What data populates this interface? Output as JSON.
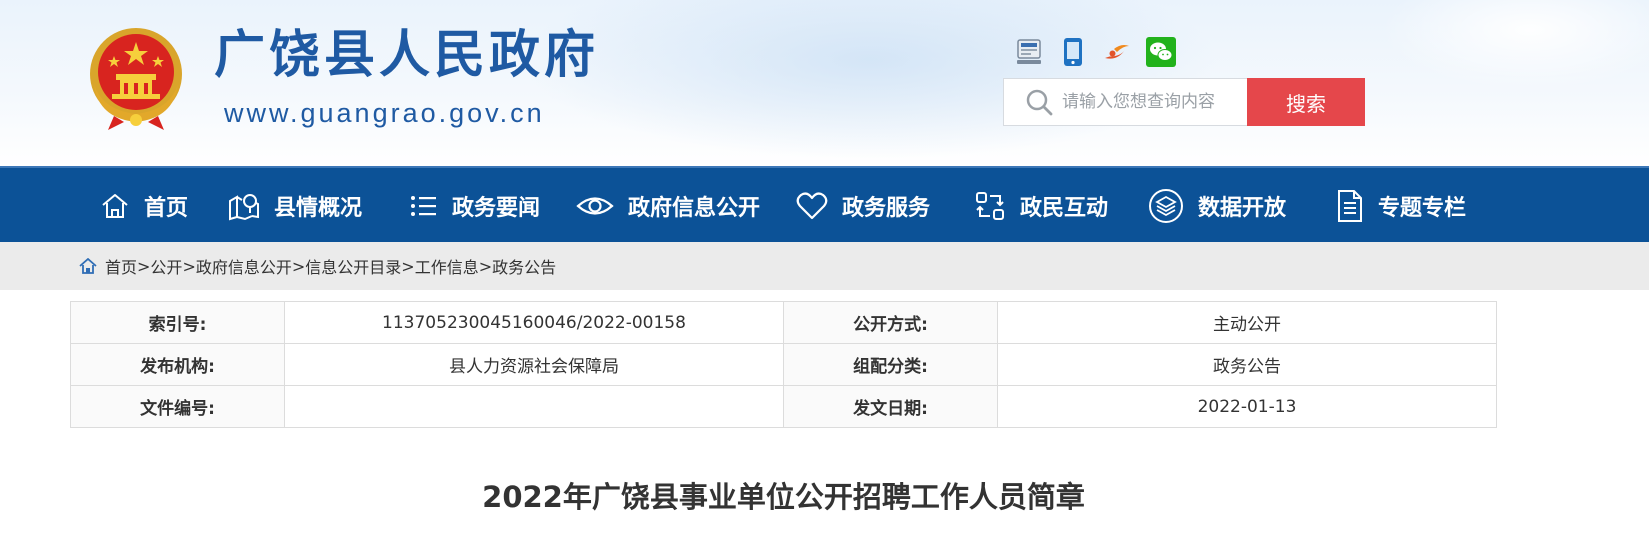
{
  "header": {
    "site_title": "广饶县人民政府",
    "site_url": "www.guangrao.gov.cn",
    "top_icons": [
      "gov-service-icon",
      "mobile-icon",
      "weibo-icon",
      "wechat-icon"
    ],
    "search": {
      "placeholder": "请输入您想查询内容",
      "button_label": "搜索"
    }
  },
  "nav": {
    "items": [
      {
        "label": "首页",
        "icon": "home-icon"
      },
      {
        "label": "县情概况",
        "icon": "map-icon"
      },
      {
        "label": "政务要闻",
        "icon": "list-icon"
      },
      {
        "label": "政府信息公开",
        "icon": "eye-icon"
      },
      {
        "label": "政务服务",
        "icon": "heart-icon"
      },
      {
        "label": "政民互动",
        "icon": "interaction-icon"
      },
      {
        "label": "数据开放",
        "icon": "layers-icon"
      },
      {
        "label": "专题专栏",
        "icon": "document-icon"
      }
    ]
  },
  "breadcrumb": {
    "items": [
      "首页",
      "公开",
      "政府信息公开",
      "信息公开目录",
      "工作信息",
      "政务公告"
    ],
    "separator": ">"
  },
  "meta": {
    "rows": [
      {
        "k1": "索引号:",
        "v1": "113705230045160046/2022-00158",
        "k2": "公开方式:",
        "v2": "主动公开"
      },
      {
        "k1": "发布机构:",
        "v1": "县人力资源社会保障局",
        "k2": "组配分类:",
        "v2": "政务公告"
      },
      {
        "k1": "文件编号:",
        "v1": "",
        "k2": "发文日期:",
        "v2": "2022-01-13"
      }
    ]
  },
  "article": {
    "title": "2022年广饶县事业单位公开招聘工作人员简章"
  },
  "colors": {
    "nav_bg": "#0c5297",
    "title_blue": "#1f5aa3",
    "search_button": "#e5474b",
    "crumb_bg": "#ebebeb"
  }
}
